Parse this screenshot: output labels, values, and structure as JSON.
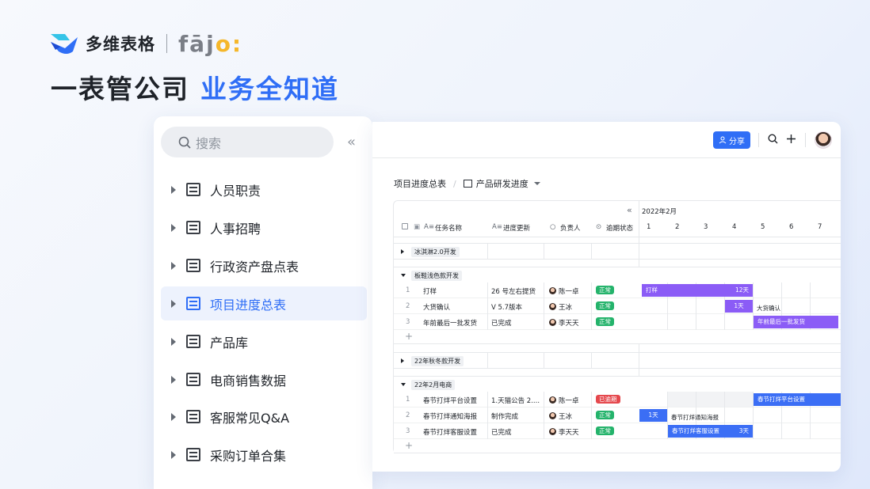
{
  "brand": {
    "name": "多维表格",
    "partner": "fājo:"
  },
  "headline": {
    "dark": "一表管公司",
    "blue": "业务全知道"
  },
  "sidebar": {
    "search_placeholder": "搜索",
    "collapse_glyph": "«",
    "items": [
      {
        "label": "人员职责"
      },
      {
        "label": "人事招聘"
      },
      {
        "label": "行政资产盘点表"
      },
      {
        "label": "项目进度总表",
        "active": true
      },
      {
        "label": "产品库"
      },
      {
        "label": "电商销售数据"
      },
      {
        "label": "客服常见Q&A"
      },
      {
        "label": "采购订单合集"
      }
    ]
  },
  "toolbar": {
    "share_label": "分享",
    "search_icon": "search-icon",
    "add_icon": "plus-icon"
  },
  "breadcrumb": {
    "table": "项目进度总表",
    "view": "产品研发进度"
  },
  "grid": {
    "columns": [
      "任务名称",
      "进度更新",
      "负责人",
      "逾期状态"
    ],
    "collapse_glyph": "«",
    "month": "2022年2月",
    "days": [
      "1",
      "2",
      "3",
      "4",
      "5",
      "6",
      "7"
    ],
    "add_glyph": "+",
    "groups": [
      {
        "name": "冰淇淋2.0开发",
        "collapsed": true
      },
      {
        "name": "板鞋浅色款开发",
        "rows": [
          {
            "n": "1",
            "task": "打样",
            "progress": "26 号左右提货",
            "owner": "陈一卓",
            "status": "正常"
          },
          {
            "n": "2",
            "task": "大货确认",
            "progress": "V 5.7版本",
            "owner": "王冰",
            "status": "正常"
          },
          {
            "n": "3",
            "task": "年前最后一批发货",
            "progress": "已完成",
            "owner": "李天天",
            "status": "正常"
          }
        ]
      },
      {
        "name": "22年秋冬款开发",
        "collapsed": true
      },
      {
        "name": "22年2月电商",
        "rows": [
          {
            "n": "1",
            "task": "春节打烊平台设置",
            "progress": "1.天猫公告 2....",
            "owner": "陈一卓",
            "status": "已逾期"
          },
          {
            "n": "2",
            "task": "春节打烊通知海报",
            "progress": "制作完成",
            "owner": "王冰",
            "status": "正常"
          },
          {
            "n": "3",
            "task": "春节打烊客服设置",
            "progress": "已完成",
            "owner": "李天天",
            "status": "正常"
          }
        ]
      }
    ],
    "bars": {
      "b1": {
        "label": "打样",
        "dur": "12天"
      },
      "b2": {
        "label": "1天",
        "side": "大货确认"
      },
      "b3": {
        "label": "年前最后一批发货"
      },
      "b4": {
        "label": "春节打烊平台设置"
      },
      "b5": {
        "label": "1天",
        "side": "春节打烊通知海报"
      },
      "b6": {
        "label": "春节打烊客服设置",
        "dur": "3天"
      }
    }
  },
  "colors": {
    "accent": "#2f6ef6",
    "purple": "#8b5cf6",
    "blue_bar": "#3b6ef5",
    "ok": "#24b36b",
    "overdue": "#e5484d"
  }
}
